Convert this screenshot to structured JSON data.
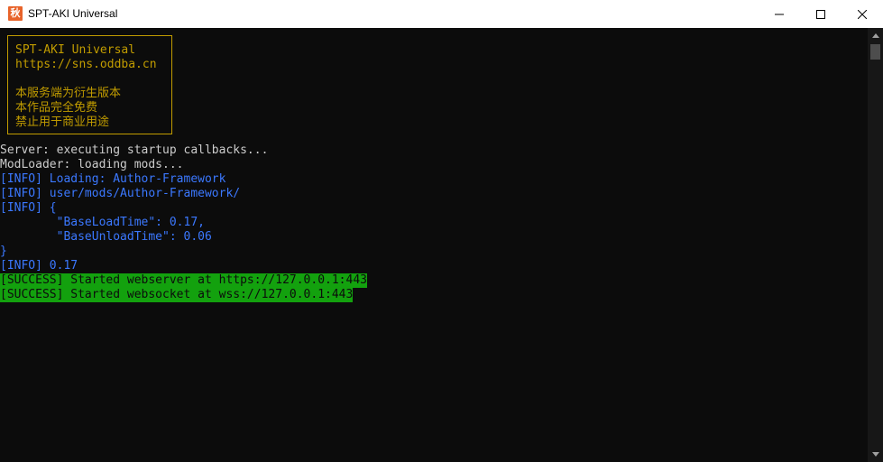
{
  "window": {
    "title": "SPT-AKI Universal",
    "icon": "app-icon",
    "icon_glyph": "秋"
  },
  "banner": {
    "lines": [
      "SPT-AKI Universal",
      "https://sns.oddba.cn",
      "",
      "本服务端为衍生版本",
      "本作品完全免费",
      "禁止用于商业用途"
    ]
  },
  "log": [
    {
      "text": "Server: executing startup callbacks...",
      "style": "white"
    },
    {
      "text": "ModLoader: loading mods...",
      "style": "white"
    },
    {
      "text": "[INFO] Loading: Author-Framework",
      "style": "blue"
    },
    {
      "text": "[INFO] user/mods/Author-Framework/",
      "style": "blue"
    },
    {
      "text": "[INFO] {",
      "style": "blue"
    },
    {
      "text": "        \"BaseLoadTime\": 0.17,",
      "style": "blue"
    },
    {
      "text": "        \"BaseUnloadTime\": 0.06",
      "style": "blue"
    },
    {
      "text": "}",
      "style": "blue"
    },
    {
      "text": "[INFO] 0.17",
      "style": "blue"
    },
    {
      "text": "[SUCCESS] Started webserver at https://127.0.0.1:443",
      "style": "success"
    },
    {
      "text": "[SUCCESS] Started websocket at wss://127.0.0.1:443",
      "style": "success"
    }
  ],
  "colors": {
    "console_bg": "#0c0c0c",
    "text": "#cccccc",
    "info": "#3b78ff",
    "banner": "#c19c00",
    "success_bg": "#13a10e"
  },
  "rgb_notes": {
    "background": "rgb(12,12,12)",
    "default_text": "rgb(204,204,204)",
    "banner_yellow": "rgb(193,156,0)",
    "info_blue": "rgb(59,120,255)",
    "success_green": "rgb(19,161,14)"
  }
}
